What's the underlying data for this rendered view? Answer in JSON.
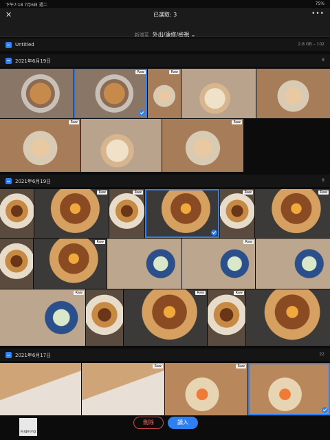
{
  "status": {
    "time": "下午7:18  7月6日 週二",
    "battery": "75%"
  },
  "header": {
    "close_icon": "close-icon",
    "title": "已選取: 3",
    "more_icon": "more-icon"
  },
  "destination": {
    "prefix": "新增至",
    "value": "外出/遠修/檢視 ⌄"
  },
  "album": {
    "label": "Untitled",
    "size": "2.8 GB – 102"
  },
  "sections": [
    {
      "label": "2021年6月19日",
      "count": "8"
    },
    {
      "label": "2021年6月19日",
      "count": "8"
    },
    {
      "label": "2021年6月17日",
      "count": "22"
    }
  ],
  "raw_badge": "Raw",
  "watermark": "eugeung",
  "actions": {
    "delete": "刪除",
    "import": "讀入"
  }
}
